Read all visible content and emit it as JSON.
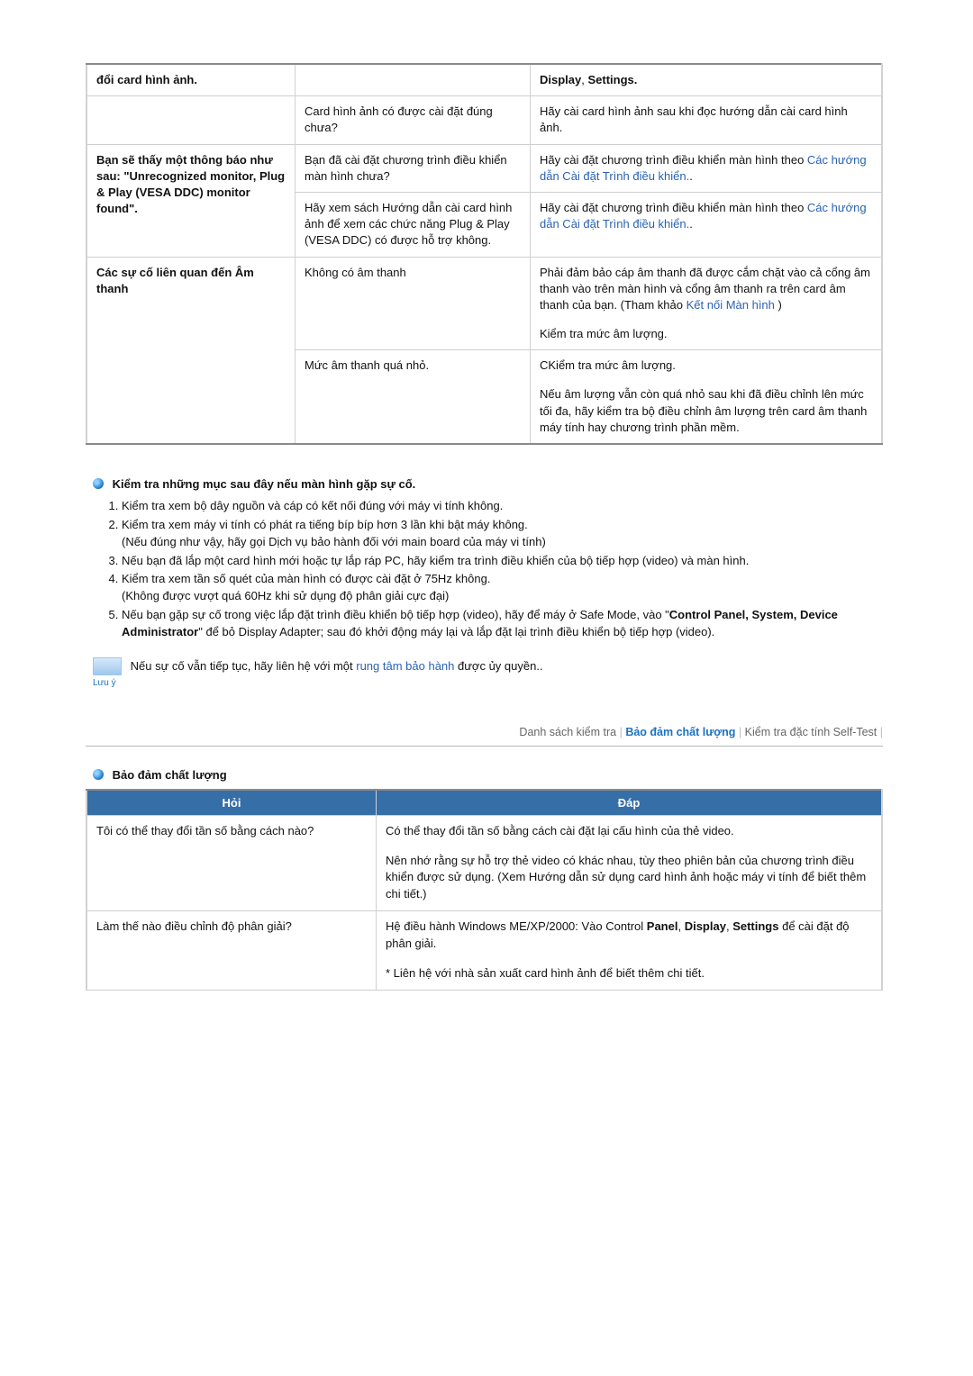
{
  "troubleshoot": {
    "r1c1": "đổi card hình ảnh.",
    "r1c3_plain": ", ",
    "r1c3_bold1": "Display",
    "r1c3_bold2": "Settings",
    "r1c3_bold3": ".",
    "r2c2": "Card hình ảnh có được cài đặt đúng chưa?",
    "r2c3": "Hãy cài card hình ảnh sau khi đọc hướng dẫn cài card hình ảnh.",
    "r3c1": "Bạn sẽ thấy một thông báo như sau: \"Unrecognized monitor, Plug & Play (VESA DDC) monitor found\".",
    "r3c2": "Bạn đã cài đặt chương trình điều khiển màn hình chưa?",
    "r3c3a": "Hãy cài đặt chương trình điều khiển màn hình theo ",
    "r3c3link": "Các hướng dẫn Cài đặt Trình điều khiển.",
    "r3c3dots": ".",
    "r4c2": "Hãy xem sách Hướng dẫn cài card hình ảnh để xem các chức năng Plug & Play (VESA DDC) có được hỗ trợ không.",
    "r4c3a": "Hãy cài đặt chương trình điều khiển màn hình theo ",
    "r4c3link": "Các hướng dẫn Cài đặt Trình điều khiển.",
    "r4c3dots": ".",
    "r5c1": "Các sự cố liên quan đến Âm thanh",
    "r5c2": "Không có âm thanh",
    "r5c3a": "Phải đảm bảo cáp âm thanh đã được cắm chặt vào cả cổng âm thanh vào trên màn hình và cổng âm thanh ra trên card âm thanh của bạn. (Tham khảo ",
    "r5c3link": "Kết nối Màn hình",
    "r5c3paren": " )",
    "r5c3b": "Kiểm tra mức âm lượng.",
    "r6c2": "Mức âm thanh quá nhỏ.",
    "r6c3a": "CKiểm tra mức âm lượng.",
    "r6c3b": "Nếu âm lượng vẫn còn quá nhỏ sau khi đã điều chỉnh lên mức tối đa, hãy kiểm tra bộ điều chỉnh âm lượng trên card âm thanh máy tính hay chương trình phần mềm."
  },
  "checklist": {
    "heading": "Kiểm tra những mục sau đây nếu màn hình gặp sự cố.",
    "items": [
      "Kiểm tra xem bộ dây nguồn và cáp có kết nối đúng với máy vi tính không.",
      "Kiểm tra xem máy vi tính có phát ra tiếng bíp bíp hơn 3 lần khi bật máy không.\n(Nếu đúng như vậy, hãy gọi Dịch vụ bảo hành đối với main board của máy vi tính)",
      "Nếu bạn đã lắp một card hình mới hoặc tự lắp ráp PC, hãy kiểm tra trình điều khiển của bộ tiếp hợp (video) và màn hình.",
      "Kiểm tra xem tần số quét của màn hình có được cài đặt ở 75Hz không.\n(Không được vượt quá 60Hz khi sử dụng độ phân giải cực đại)",
      "Nếu bạn gặp sự cố trong việc lắp đặt trình điều khiển bộ tiếp hợp (video), hãy để máy ở Safe Mode, vào \"",
      "\" để bỏ Display Adapter; sau đó khởi động máy lại và lắp đặt lại trình điều khiển bộ tiếp hợp (video)."
    ],
    "item5bold": "Control Panel, System, Device Administrator"
  },
  "note": {
    "label": "Lưu ý",
    "text_a": "Nếu sự cố vẫn tiếp tục, hãy liên hệ với một ",
    "link": "rung tâm bảo hành",
    "text_b": " được ủy quyền.."
  },
  "tabs": {
    "t1": "Danh sách kiểm tra",
    "t2": "Bảo đảm chất lượng",
    "t3": "Kiểm tra đặc tính Self-Test"
  },
  "qa": {
    "section_title": "Bảo đảm chất lượng",
    "head_q": "Hỏi",
    "head_a": "Đáp",
    "q1": "Tôi có thể thay đổi tần số bằng cách nào?",
    "a1a": "Có thể thay đổi tần số bằng cách cài đặt lại cấu hình của thẻ video.",
    "a1b": "Nên nhớ rằng sự hỗ trợ thẻ video có khác nhau, tùy theo phiên bản của chương trình điều khiển được sử dụng. (Xem Hướng dẫn sử dụng card hình ảnh hoặc máy vi tính để biết thêm chi tiết.)",
    "q2": "Làm thế nào điều chỉnh độ phân giải?",
    "a2a_pre": "Hệ điều hành Windows ME/XP/2000: Vào Control ",
    "a2a_b1": "Panel",
    "a2a_b2": "Display",
    "a2a_b3": "Settings",
    "a2a_post": " để cài đặt độ phân giải.",
    "a2b": "* Liên hệ với nhà sản xuất card hình ảnh để biết thêm chi tiết."
  }
}
